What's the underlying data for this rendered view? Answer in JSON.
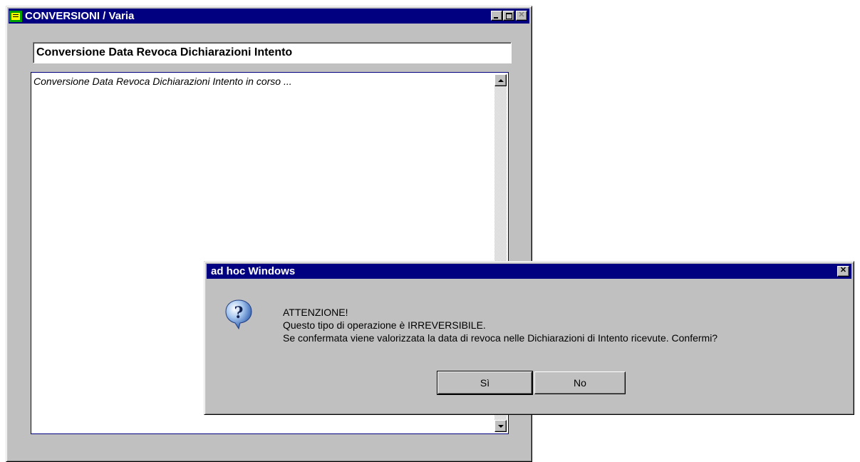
{
  "main_window": {
    "title": "CONVERSIONI / Varia",
    "header_text": "Conversione Data Revoca Dichiarazioni Intento",
    "log_text": "Conversione Data Revoca Dichiarazioni Intento in corso ...",
    "icon": "app-icon"
  },
  "dialog": {
    "title": "ad hoc Windows",
    "line1": "ATTENZIONE!",
    "line2": "Questo tipo di operazione è IRREVERSIBILE.",
    "line3": "Se confermata viene valorizzata la data di revoca nelle Dichiarazioni di Intento ricevute. Confermi?",
    "yes_label": "Sì",
    "no_label": "No",
    "icon": "question-icon"
  },
  "colors": {
    "titlebar": "#000080",
    "face": "#c0c0c0"
  }
}
